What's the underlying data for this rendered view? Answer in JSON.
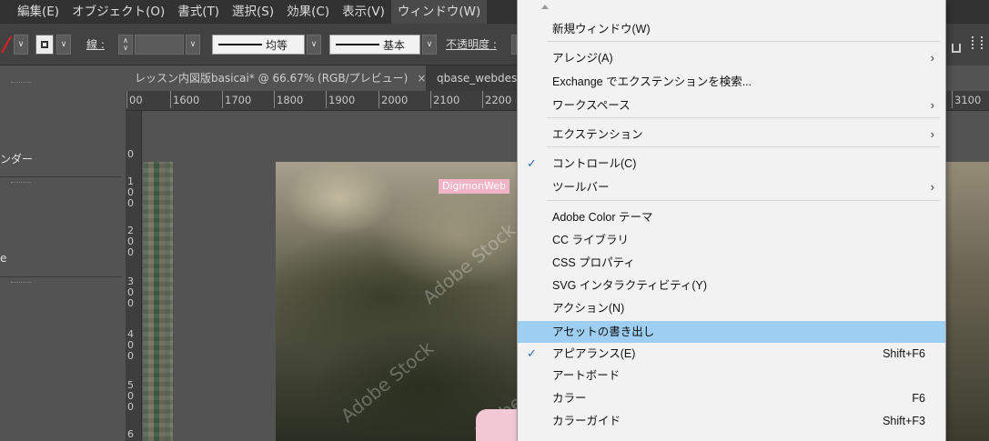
{
  "menubar": {
    "items": [
      {
        "label": "編集(E)"
      },
      {
        "label": "オブジェクト(O)"
      },
      {
        "label": "書式(T)"
      },
      {
        "label": "選択(S)"
      },
      {
        "label": "効果(C)"
      },
      {
        "label": "表示(V)"
      },
      {
        "label": "ウィンドウ(W)"
      }
    ]
  },
  "controlbar": {
    "stroke_label": "線 :",
    "profile_label": "均等",
    "brush_label": "基本",
    "opacity_label": "不透明度 :"
  },
  "tabs": [
    {
      "label": "レッスン内図版basicai* @ 66.67% (RGB/プレビュー)",
      "close": "×"
    },
    {
      "label": "qbase_webdesig"
    }
  ],
  "ruler": {
    "h_ticks": [
      "00",
      "1600",
      "1700",
      "1800",
      "1900",
      "2000",
      "2100",
      "2200"
    ],
    "h_ticks_right": [
      "3100"
    ],
    "v_ticks": [
      "0",
      "1",
      "0",
      "0",
      "2",
      "0",
      "0",
      "3",
      "0",
      "0",
      "4",
      "0",
      "0",
      "5",
      "0",
      "0",
      "6"
    ]
  },
  "left_panel": {
    "labels": [
      "ンダー",
      "e"
    ]
  },
  "canvas": {
    "watermark_label": "DigimonWeb",
    "watermark_text": "Adobe Stock"
  },
  "window_menu": {
    "items": [
      {
        "label": "新規ウィンドウ(W)",
        "shortcut": "",
        "submenu": false,
        "checked": false
      },
      {
        "label": "アレンジ(A)",
        "shortcut": "",
        "submenu": true,
        "checked": false
      },
      {
        "label": "Exchange でエクステンションを検索...",
        "shortcut": "",
        "submenu": false,
        "checked": false
      },
      {
        "label": "ワークスペース",
        "shortcut": "",
        "submenu": true,
        "checked": false
      },
      {
        "label": "エクステンション",
        "shortcut": "",
        "submenu": true,
        "checked": false
      },
      {
        "label": "コントロール(C)",
        "shortcut": "",
        "submenu": false,
        "checked": true
      },
      {
        "label": "ツールバー",
        "shortcut": "",
        "submenu": true,
        "checked": false
      },
      {
        "label": "Adobe Color テーマ",
        "shortcut": "",
        "submenu": false,
        "checked": false
      },
      {
        "label": "CC ライブラリ",
        "shortcut": "",
        "submenu": false,
        "checked": false
      },
      {
        "label": "CSS プロパティ",
        "shortcut": "",
        "submenu": false,
        "checked": false
      },
      {
        "label": "SVG インタラクティビティ(Y)",
        "shortcut": "",
        "submenu": false,
        "checked": false
      },
      {
        "label": "アクション(N)",
        "shortcut": "",
        "submenu": false,
        "checked": false
      },
      {
        "label": "アセットの書き出し",
        "shortcut": "",
        "submenu": false,
        "checked": false,
        "highlighted": true
      },
      {
        "label": "アピアランス(E)",
        "shortcut": "Shift+F6",
        "submenu": false,
        "checked": true
      },
      {
        "label": "アートボード",
        "shortcut": "",
        "submenu": false,
        "checked": false
      },
      {
        "label": "カラー",
        "shortcut": "F6",
        "submenu": false,
        "checked": false
      },
      {
        "label": "カラーガイド",
        "shortcut": "Shift+F3",
        "submenu": false,
        "checked": false
      }
    ],
    "check_glyph": "✓",
    "arrow_glyph": "›"
  },
  "colors": {
    "highlight": "#9ecff2",
    "check": "#2a6fba",
    "menubar_bg": "#323232"
  }
}
